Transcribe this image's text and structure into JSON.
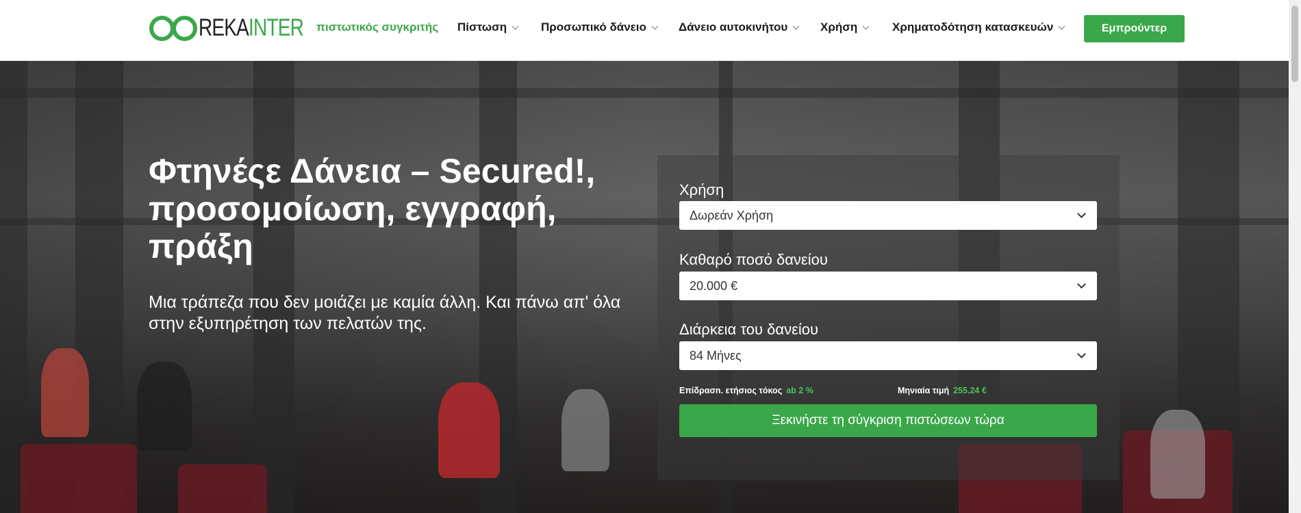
{
  "brand": {
    "logo_dark": "REKA",
    "logo_green": "INTER",
    "accent": "#3aa84a"
  },
  "nav": {
    "items": [
      {
        "label": "πιστωτικός συγκριτής",
        "dropdown": false,
        "active": true
      },
      {
        "label": "Πίστωση",
        "dropdown": true
      },
      {
        "label": "Προσωπικό δάνειο",
        "dropdown": true
      },
      {
        "label": "Δάνειο αυτοκινήτου",
        "dropdown": true
      },
      {
        "label": "Χρήση",
        "dropdown": true
      },
      {
        "label": "Χρηματοδότηση κατασκευών",
        "dropdown": true
      }
    ],
    "login_label": "Εμπρούντερ"
  },
  "hero": {
    "title": "Φτηνέςε Δάνεια – Secured!, προσομοίωση, εγγραφή, πράξη",
    "subtitle": "Μια τράπεζα που δεν μοιάζει με καμία άλλη. Και πάνω απ' όλα στην εξυπηρέτηση των πελατών της."
  },
  "form": {
    "usage_label": "Χρήση",
    "usage_value": "Δωρεάν Χρήση",
    "amount_label": "Καθαρό ποσό δανείου",
    "amount_value": "20.000 €",
    "duration_label": "Διάρκεια του δανείου",
    "duration_value": "84 Μήνες",
    "rate_label": "Επίδρασn. ετήσιος τόκος",
    "rate_value": "ab 2  %",
    "monthly_label": "Μηνιαία τιμή",
    "monthly_value": "255.24  €",
    "cta_label": "Ξεκινήστε τη σύγκριση πιστώσεων τώρα"
  }
}
